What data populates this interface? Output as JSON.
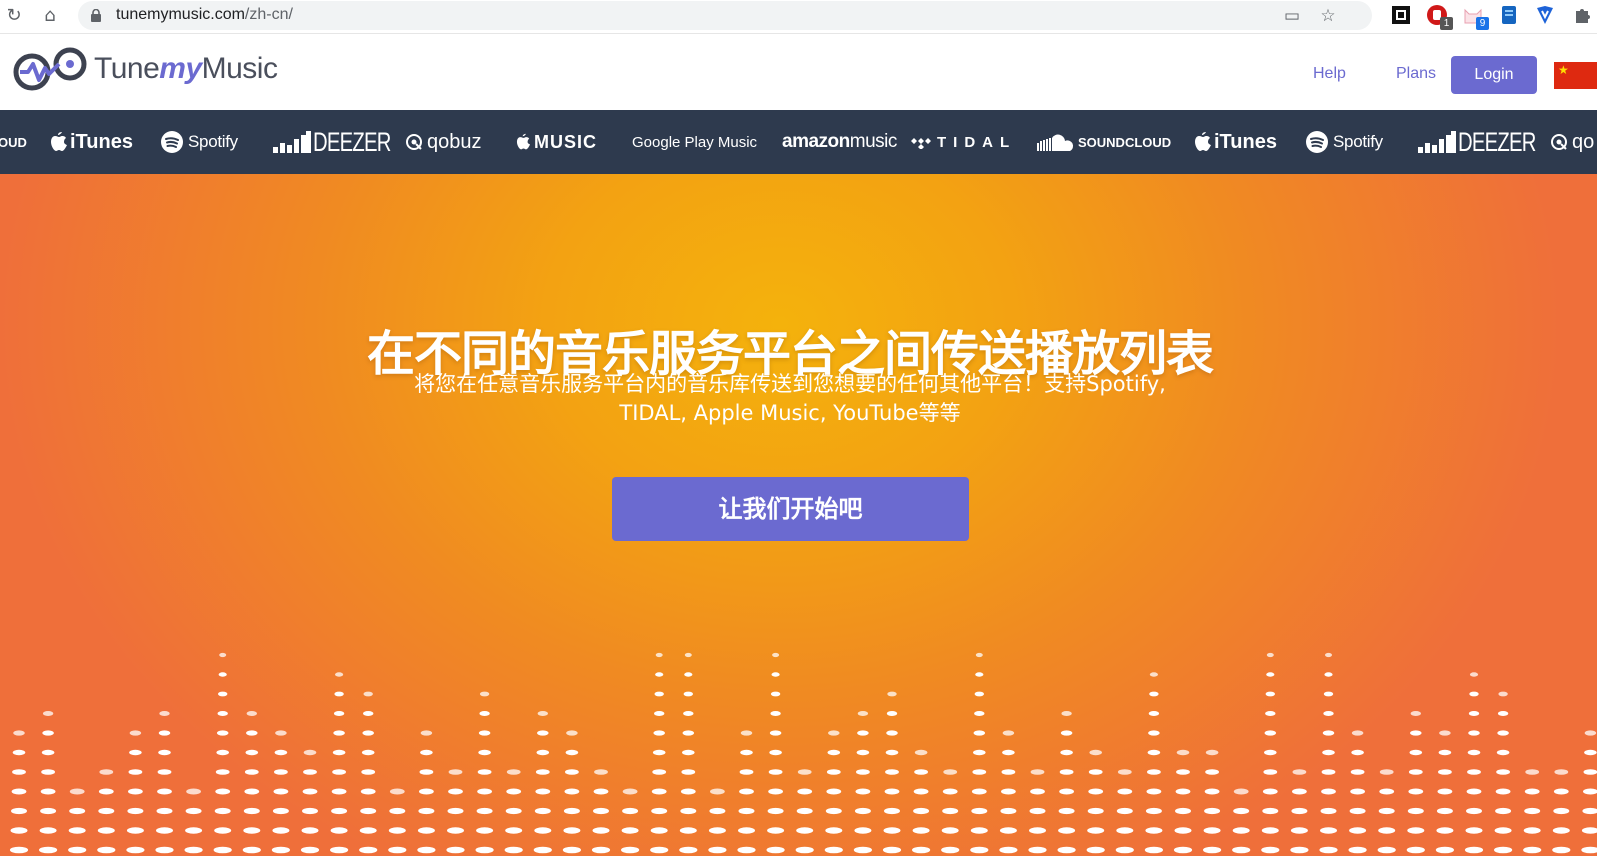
{
  "browser": {
    "url_host": "tunemymusic.com",
    "url_path": "/zh-cn/",
    "extensions": [
      {
        "name": "qr-extension-icon",
        "badge": ""
      },
      {
        "name": "adblock-extension-icon",
        "badge": "1"
      },
      {
        "name": "cat-extension-icon",
        "badge": "9"
      },
      {
        "name": "note-extension-icon",
        "badge": ""
      },
      {
        "name": "shield-extension-icon",
        "badge": ""
      },
      {
        "name": "puzzle-icon",
        "badge": ""
      }
    ]
  },
  "header": {
    "logo_text_1": "Tune",
    "logo_text_2": "my",
    "logo_text_3": "Music",
    "nav": {
      "help": "Help",
      "plans": "Plans",
      "login": "Login"
    }
  },
  "services_strip": [
    "OUD",
    "iTunes",
    "Spotify",
    "DEEZER",
    "qobuz",
    "MUSIC",
    "Google Play Music",
    "amazon",
    "music",
    "TIDAL",
    "SOUNDCLOUD",
    "iTunes",
    "Spotify",
    "DEEZER",
    "qo"
  ],
  "hero": {
    "title": "在不同的音乐服务平台之间传送播放列表",
    "subtitle_line1": "将您在任意音乐服务平台内的音乐库传送到您想要的任何其他平台！支持Spotify,",
    "subtitle_line2": "TIDAL, Apple Music, YouTube等等",
    "cta": "让我们开始吧"
  },
  "colors": {
    "brand_purple": "#6b6ad0",
    "strip_bg": "#2e3a4e",
    "hero_orange": "#f3a212",
    "flag_red": "#de2910"
  }
}
